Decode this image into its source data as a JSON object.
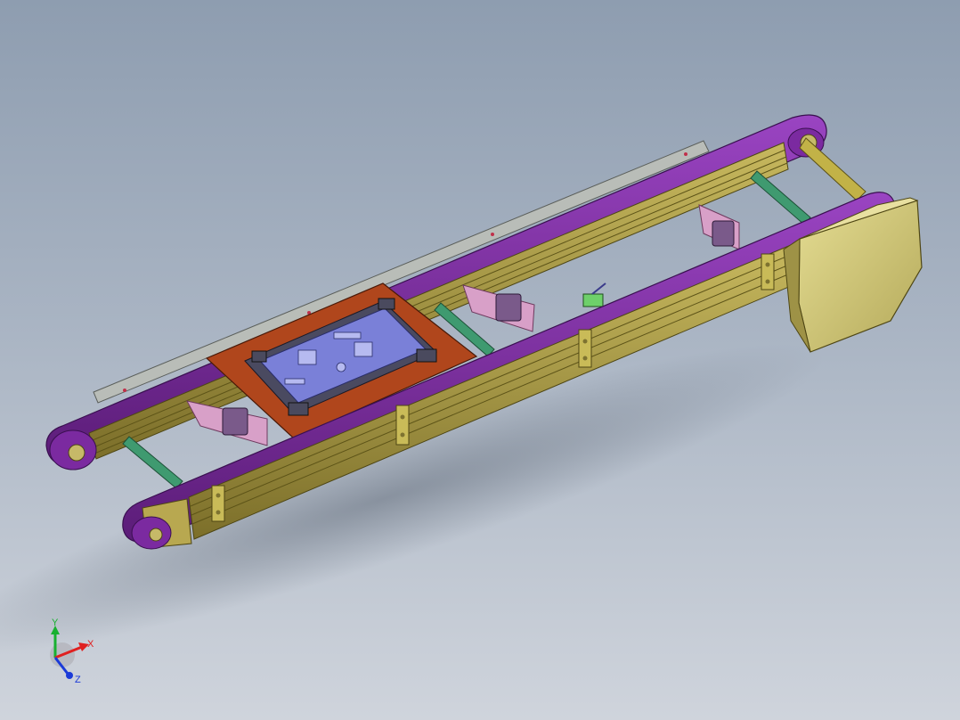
{
  "triad": {
    "x_label": "X",
    "y_label": "Y",
    "z_label": "Z",
    "colors": {
      "x": "#e02020",
      "y": "#18b030",
      "z": "#1a3ad8"
    }
  },
  "colors": {
    "frame": "#a99a45",
    "belt": "#7b2aa0",
    "cover": "#d7cf80",
    "plate": "#b0461c",
    "pcb": "#7a80d8",
    "rail": "#b8f0b0",
    "shaft": "#3f9a70",
    "bracket": "#d8a0c8"
  }
}
